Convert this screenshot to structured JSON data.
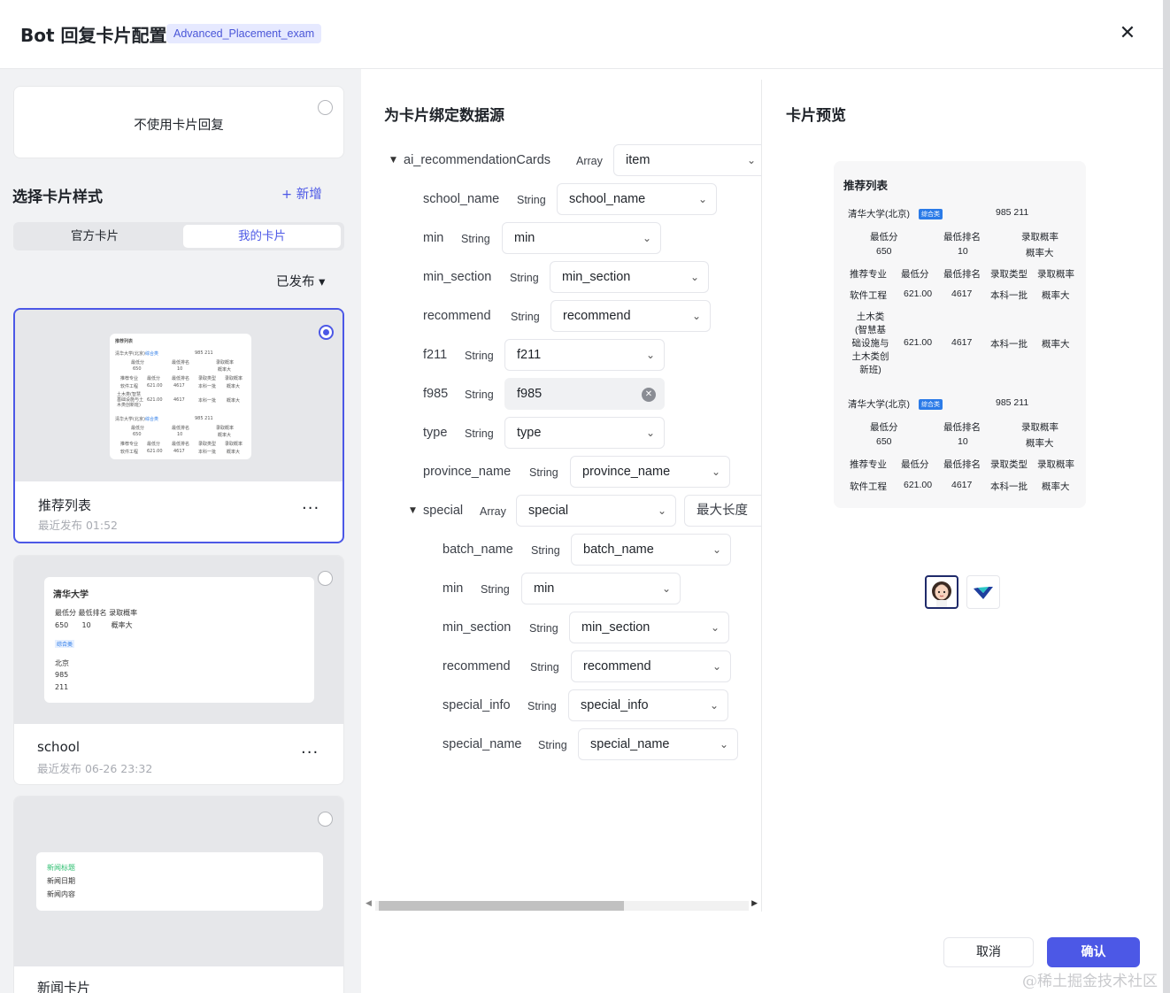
{
  "header": {
    "title": "Bot 回复卡片配置",
    "tag": "Advanced_Placement_exam",
    "close_icon": "close-icon"
  },
  "left": {
    "no_card_label": "不使用卡片回复",
    "section_title": "选择卡片样式",
    "add_label": "+ 新增",
    "tabs": [
      "官方卡片",
      "我的卡片"
    ],
    "active_tab": "我的卡片",
    "filter_label": "已发布 ▾",
    "cards": [
      {
        "name": "推荐列表",
        "time": "最近发布 01:52",
        "more": "···",
        "selected": true,
        "thumb": {
          "title": "推荐列表",
          "school": "清华大学(北京)",
          "badge": "综合类",
          "tags": "985 211",
          "h1": "最低分",
          "h2": "最低排名",
          "h3": "录取概率",
          "v1": "650",
          "v2": "10",
          "v3": "概率大",
          "cols": [
            "推荐专业",
            "最低分",
            "最低排名",
            "录取类型",
            "录取概率"
          ],
          "r1": [
            "软件工程",
            "621.00",
            "4617",
            "本科一批",
            "概率大"
          ],
          "r2": [
            "土木类(智慧基础设施与土木类创新班)",
            "621.00",
            "4617",
            "本科一批",
            "概率大"
          ]
        }
      },
      {
        "name": "school",
        "time": "最近发布 06-26 23:32",
        "more": "···",
        "selected": false,
        "thumb": {
          "title": "清华大学",
          "h": "最低分  最低排名  录取概率",
          "v": "650      10         概率大",
          "badge": "综合类",
          "city": "北京",
          "t1": "985",
          "t2": "211"
        }
      },
      {
        "name": "新闻卡片",
        "selected": false,
        "thumb": {
          "title": "新闻标题",
          "date": "新闻日期",
          "content": "新闻内容"
        }
      }
    ]
  },
  "middle": {
    "title": "为卡片绑定数据源",
    "root": {
      "name": "ai_recommendationCards",
      "type": "Array",
      "value": "item"
    },
    "fields": [
      {
        "name": "school_name",
        "type": "String",
        "value": "school_name"
      },
      {
        "name": "min",
        "type": "String",
        "value": "min"
      },
      {
        "name": "min_section",
        "type": "String",
        "value": "min_section"
      },
      {
        "name": "recommend",
        "type": "String",
        "value": "recommend"
      },
      {
        "name": "f211",
        "type": "String",
        "value": "f211"
      },
      {
        "name": "f985",
        "type": "String",
        "value": "f985"
      },
      {
        "name": "type",
        "type": "String",
        "value": "type"
      },
      {
        "name": "province_name",
        "type": "String",
        "value": "province_name"
      }
    ],
    "special": {
      "name": "special",
      "type": "Array",
      "value": "special",
      "max_len_label": "最大长度"
    },
    "special_fields": [
      {
        "name": "batch_name",
        "type": "String",
        "value": "batch_name"
      },
      {
        "name": "min",
        "type": "String",
        "value": "min"
      },
      {
        "name": "min_section",
        "type": "String",
        "value": "min_section"
      },
      {
        "name": "recommend",
        "type": "String",
        "value": "recommend"
      },
      {
        "name": "special_info",
        "type": "String",
        "value": "special_info"
      },
      {
        "name": "special_name",
        "type": "String",
        "value": "special_name"
      }
    ]
  },
  "preview": {
    "title": "卡片预览",
    "card_title": "推荐列表",
    "blocks": [
      {
        "school": "清华大学(北京)",
        "badge": "综合类",
        "tags": "985 211",
        "h1": "最低分",
        "h2": "最低排名",
        "h3": "录取概率",
        "v1": "650",
        "v2": "10",
        "v3": "概率大",
        "cols": [
          "推荐专业",
          "最低分",
          "最低排名",
          "录取类型",
          "录取概率"
        ],
        "rows": [
          [
            "软件工程",
            "621.00",
            "4617",
            "本科一批",
            "概率大"
          ],
          [
            "土木类\n(智慧基\n础设施与\n土木类创\n新班)",
            "621.00",
            "4617",
            "本科一批",
            "概率大"
          ]
        ]
      },
      {
        "school": "清华大学(北京)",
        "badge": "综合类",
        "tags": "985 211",
        "h1": "最低分",
        "h2": "最低排名",
        "h3": "录取概率",
        "v1": "650",
        "v2": "10",
        "v3": "概率大",
        "cols": [
          "推荐专业",
          "最低分",
          "最低排名",
          "录取类型",
          "录取概率"
        ],
        "rows": [
          [
            "软件工程",
            "621.00",
            "4617",
            "本科一批",
            "概率大"
          ]
        ]
      }
    ]
  },
  "footer": {
    "cancel": "取消",
    "confirm": "确认",
    "watermark": "@稀土掘金技术社区"
  },
  "colors": {
    "accent": "#4c58e6",
    "panel": "#f1f2f4"
  }
}
